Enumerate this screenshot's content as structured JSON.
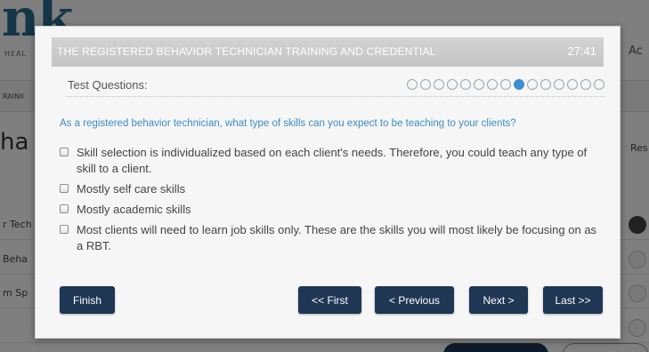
{
  "background": {
    "logo": "nk",
    "logo_sub": "HEAL",
    "top_nav_fragment": "Ac",
    "breadcrumb": "RAINII",
    "heading_fragment": "ha",
    "side_fragment": "Res",
    "rows": [
      "r Tech",
      "Beha",
      "m Sp",
      ""
    ]
  },
  "modal": {
    "title": "THE REGISTERED BEHAVIOR TECHNICIAN TRAINING AND CREDENTIAL",
    "timer": "27:41",
    "test_questions_label": "Test Questions:",
    "progress": {
      "total": 15,
      "current": 9
    },
    "question": "As a registered behavior technician, what type of skills can you expect to be teaching to your clients?",
    "options": [
      "Skill selection is individualized based on each client's needs. Therefore, you could teach any type of skill to a client.",
      "Mostly self care skills",
      "Mostly academic skills",
      "Most clients will need to learn job skills only. These are the skills you will most likely be focusing on as a RBT."
    ],
    "buttons": {
      "finish": "Finish",
      "first": "<< First",
      "previous": "< Previous",
      "next": "Next >",
      "last": "Last >>"
    }
  },
  "colors": {
    "header_bg": "#c9c9c9",
    "button_bg": "#1f3655",
    "question_text": "#3a8cc6",
    "active_dot": "#3b8ed0"
  }
}
